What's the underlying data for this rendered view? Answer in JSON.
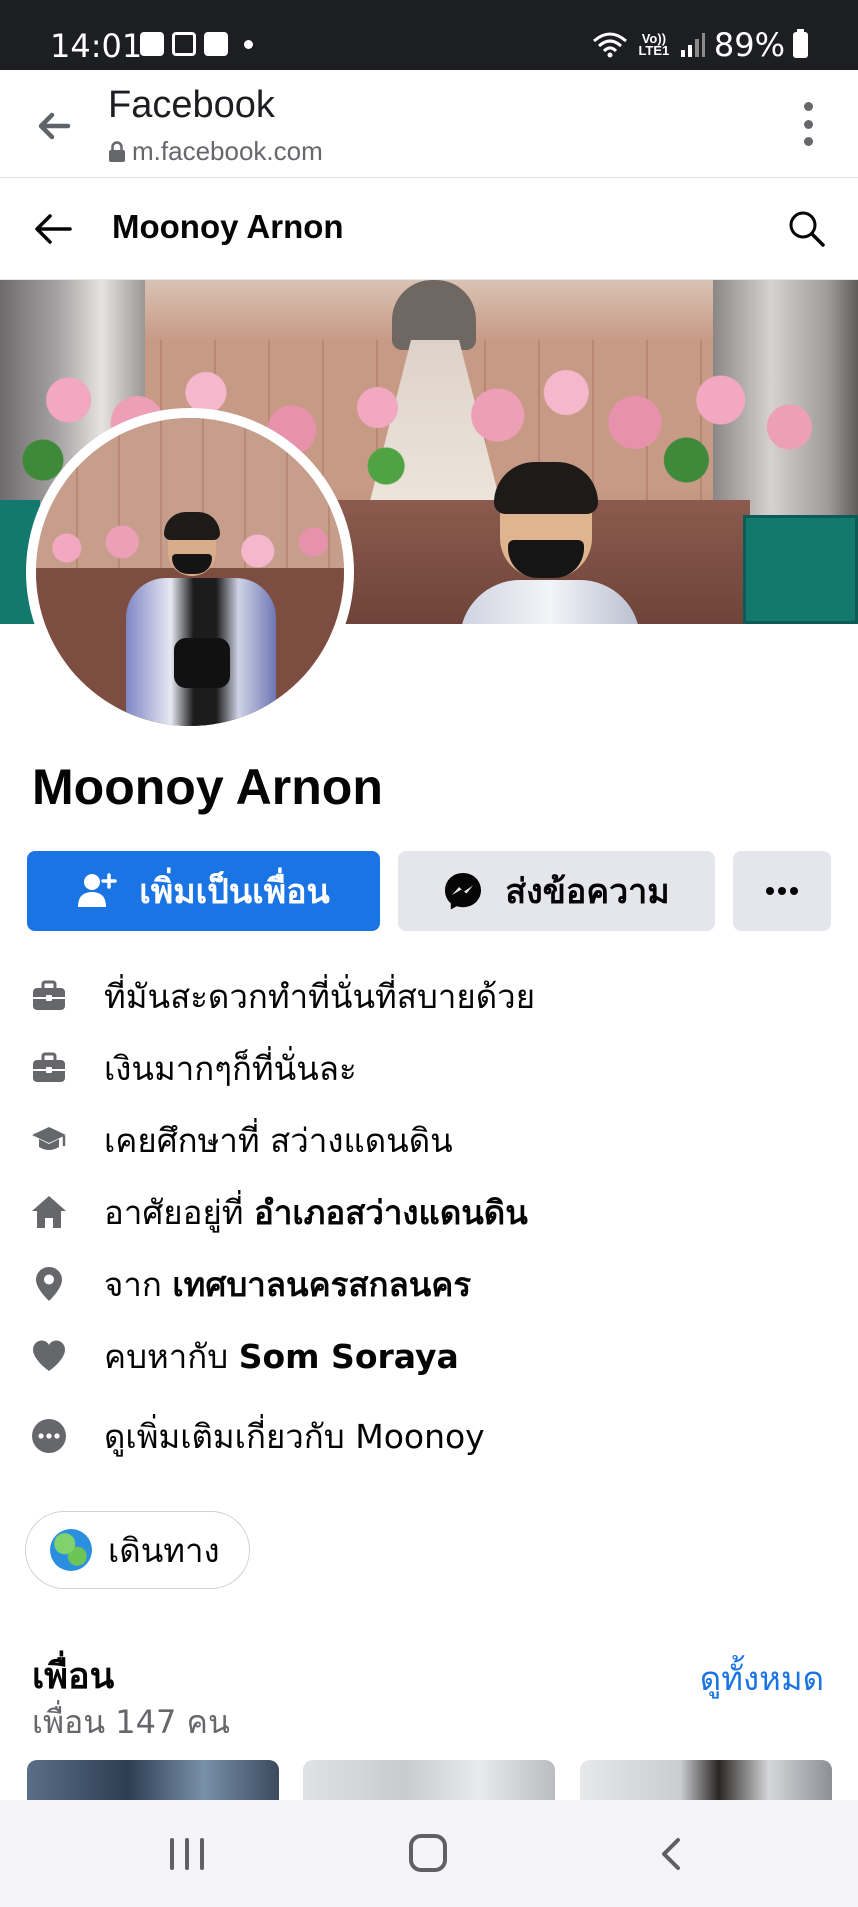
{
  "status_bar": {
    "time": "14:01",
    "network": "Vo)) LTE1",
    "battery": "89%",
    "icons": [
      "gallery-icon",
      "capcut-icon",
      "youtube-icon",
      "notification-dot-icon",
      "wifi-icon",
      "signal-icon",
      "battery-icon"
    ]
  },
  "browser": {
    "title": "Facebook",
    "url": "m.facebook.com",
    "icons": [
      "back-arrow-icon",
      "lock-icon",
      "more-vertical-icon"
    ]
  },
  "page_nav": {
    "title": "Moonoy Arnon",
    "icons": [
      "back-arrow-icon",
      "search-icon"
    ]
  },
  "profile": {
    "name": "Moonoy Arnon"
  },
  "actions": {
    "add_friend": "เพิ่มเป็นเพื่อน",
    "message": "ส่งข้อความ",
    "more": "more-horizontal-icon"
  },
  "intro": {
    "work_1": "ที่มันสะดวกทำที่นั่นที่สบายด้วย",
    "work_2": "เงินมากๆก็ที่นั่นละ",
    "education": "เคยศึกษาที่ สว่างแดนดิน",
    "lives_prefix": "อาศัยอยู่ที่ ",
    "lives_place": "อำเภอสว่างแดนดิน",
    "from_prefix": "จาก ",
    "from_place": "เทศบาลนครสกลนคร",
    "relationship_prefix": "คบหากับ ",
    "relationship_name": "Som Soraya",
    "see_more": "ดูเพิ่มเติมเกี่ยวกับ Moonoy"
  },
  "chips": {
    "travel": "เดินทาง"
  },
  "friends": {
    "title": "เพื่อน",
    "count": "เพื่อน 147 คน",
    "see_all": "ดูทั้งหมด"
  },
  "colors": {
    "primary": "#1b74e4",
    "button_gray": "#e4e6eb",
    "secondary_text": "#65676b",
    "status_bar": "#1c1e21"
  }
}
